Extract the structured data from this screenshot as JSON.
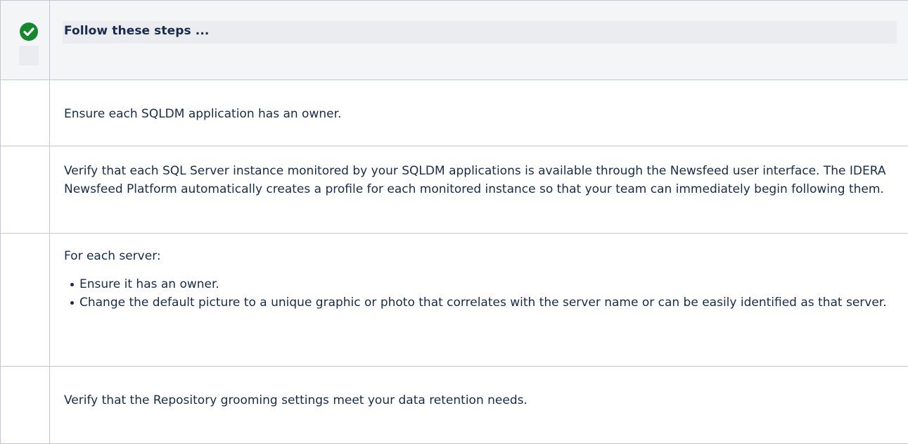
{
  "callout": {
    "icon": "check-circle-icon",
    "icon_color": "#14892c",
    "header_bg": "#f4f5f7",
    "border_color": "#c1c7d0",
    "title": "Follow these steps ..."
  },
  "steps": [
    {
      "text": "Ensure each SQLDM application has an owner."
    },
    {
      "text": "Verify that each SQL Server instance monitored by your SQLDM applications is available through the Newsfeed user interface. The IDERA Newsfeed Platform automatically creates a profile for each monitored instance so that your team can immediately begin following them."
    },
    {
      "text": "For each server:",
      "bullets": [
        "Ensure it has an owner.",
        "Change the default picture to a unique graphic or photo that correlates with the server name or can be easily identified as that server."
      ]
    },
    {
      "text": "Verify that the Repository grooming settings meet your data retention needs."
    }
  ]
}
